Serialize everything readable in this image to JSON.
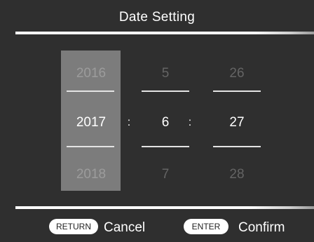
{
  "title": "Date Setting",
  "picker": {
    "year": {
      "prev": "2016",
      "current": "2017",
      "next": "2018"
    },
    "month": {
      "prev": "5",
      "current": "6",
      "next": "7"
    },
    "day": {
      "prev": "26",
      "current": "27",
      "next": "28"
    },
    "separator": ":"
  },
  "footer": {
    "return": {
      "key": "RETURN",
      "label": "Cancel"
    },
    "enter": {
      "key": "ENTER",
      "label": "Confirm"
    }
  }
}
